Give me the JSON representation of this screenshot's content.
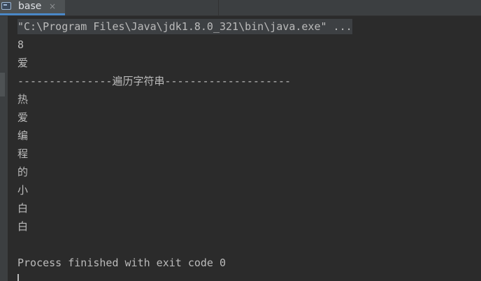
{
  "tab": {
    "label": "base",
    "close": "×",
    "icon": "console-window-icon"
  },
  "console": {
    "command": "\"C:\\Program Files\\Java\\jdk1.8.0_321\\bin\\java.exe\" ...",
    "lines": [
      "8",
      "爱",
      "---------------遍历字符串--------------------",
      "热",
      "爱",
      "编",
      "程",
      "的",
      "小",
      "白",
      "白",
      "",
      "Process finished with exit code 0"
    ]
  },
  "colors": {
    "background": "#2b2b2b",
    "text": "#bbbbbb",
    "tab_accent": "#4a88c7"
  }
}
